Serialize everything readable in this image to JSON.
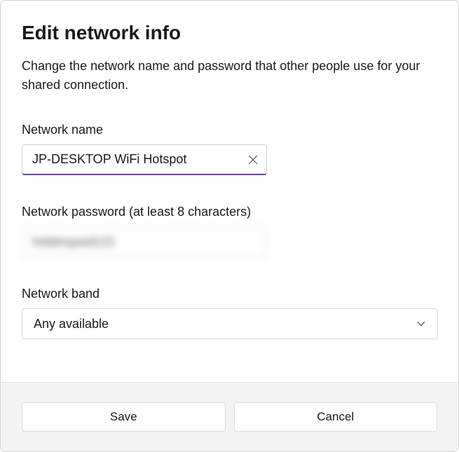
{
  "dialog": {
    "title": "Edit network info",
    "subtitle": "Change the network name and password that other people use for your shared connection."
  },
  "fields": {
    "name": {
      "label": "Network name",
      "value": "JP-DESKTOP WiFi Hotspot"
    },
    "password": {
      "label": "Network password (at least 8 characters)",
      "value": "hiddenpwd123"
    },
    "band": {
      "label": "Network band",
      "selected": "Any available"
    }
  },
  "buttons": {
    "save": "Save",
    "cancel": "Cancel"
  }
}
